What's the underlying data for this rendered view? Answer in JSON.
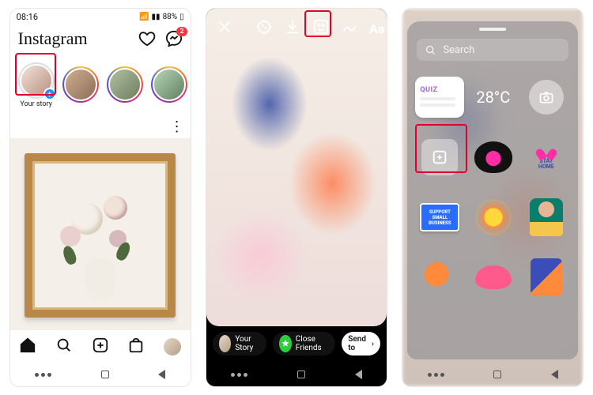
{
  "phone1": {
    "status_time": "08:16",
    "battery": "88%",
    "app_name": "Instagram",
    "dm_badge": "2",
    "stories": [
      {
        "label": "Your story",
        "own": true
      },
      {
        "label": ""
      },
      {
        "label": ""
      },
      {
        "label": ""
      }
    ]
  },
  "phone2": {
    "tool_text_label": "Aa",
    "your_story_label": "Your Story",
    "close_friends_label": "Close Friends",
    "send_to_label": "Send to"
  },
  "phone3": {
    "search_placeholder": "Search",
    "stickers": {
      "quiz_title": "QUIZ",
      "temperature": "28°C",
      "stay_home_line1": "STAY",
      "stay_home_line2": "HOME",
      "ssb": "SUPPORT SMALL BUSINESS"
    }
  }
}
